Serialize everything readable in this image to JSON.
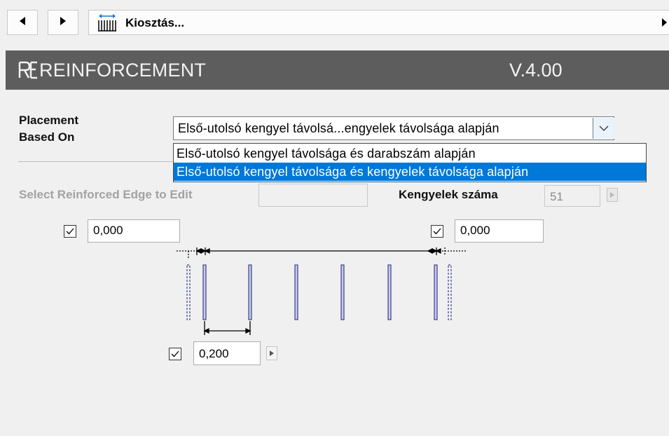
{
  "toolbar": {
    "back_icon": "triangle-left-icon",
    "forward_icon": "triangle-right-icon",
    "distribution_icon": "stirrup-distribution-icon",
    "title": "Kiosztás...",
    "scroll_right_icon": "triangle-right-icon"
  },
  "header": {
    "logo": "RF",
    "title": "REINFORCEMENT",
    "version": "V.4.00"
  },
  "placement": {
    "label_line1": "Placement",
    "label_line2": "Based On",
    "selected": "Első-utolsó kengyel távolsá...engyelek távolsága alapján",
    "options": [
      "Első-utolsó kengyel távolsága és darabszám alapján",
      "Első-utolsó kengyel távolsága és kengyelek távolsága alapján"
    ],
    "highlighted_index": 1
  },
  "edge": {
    "label": "Select Reinforced Edge to Edit",
    "value": ""
  },
  "count": {
    "label": "Kengyelek száma",
    "value": "51"
  },
  "left_offset": {
    "checked": true,
    "value": "0,000"
  },
  "right_offset": {
    "checked": true,
    "value": "0,000"
  },
  "spacing": {
    "checked": true,
    "value": "0,200"
  },
  "colors": {
    "header_bg": "#5d5d5d",
    "highlight": "#0078d7",
    "stirrup": "#3b3f8f"
  }
}
